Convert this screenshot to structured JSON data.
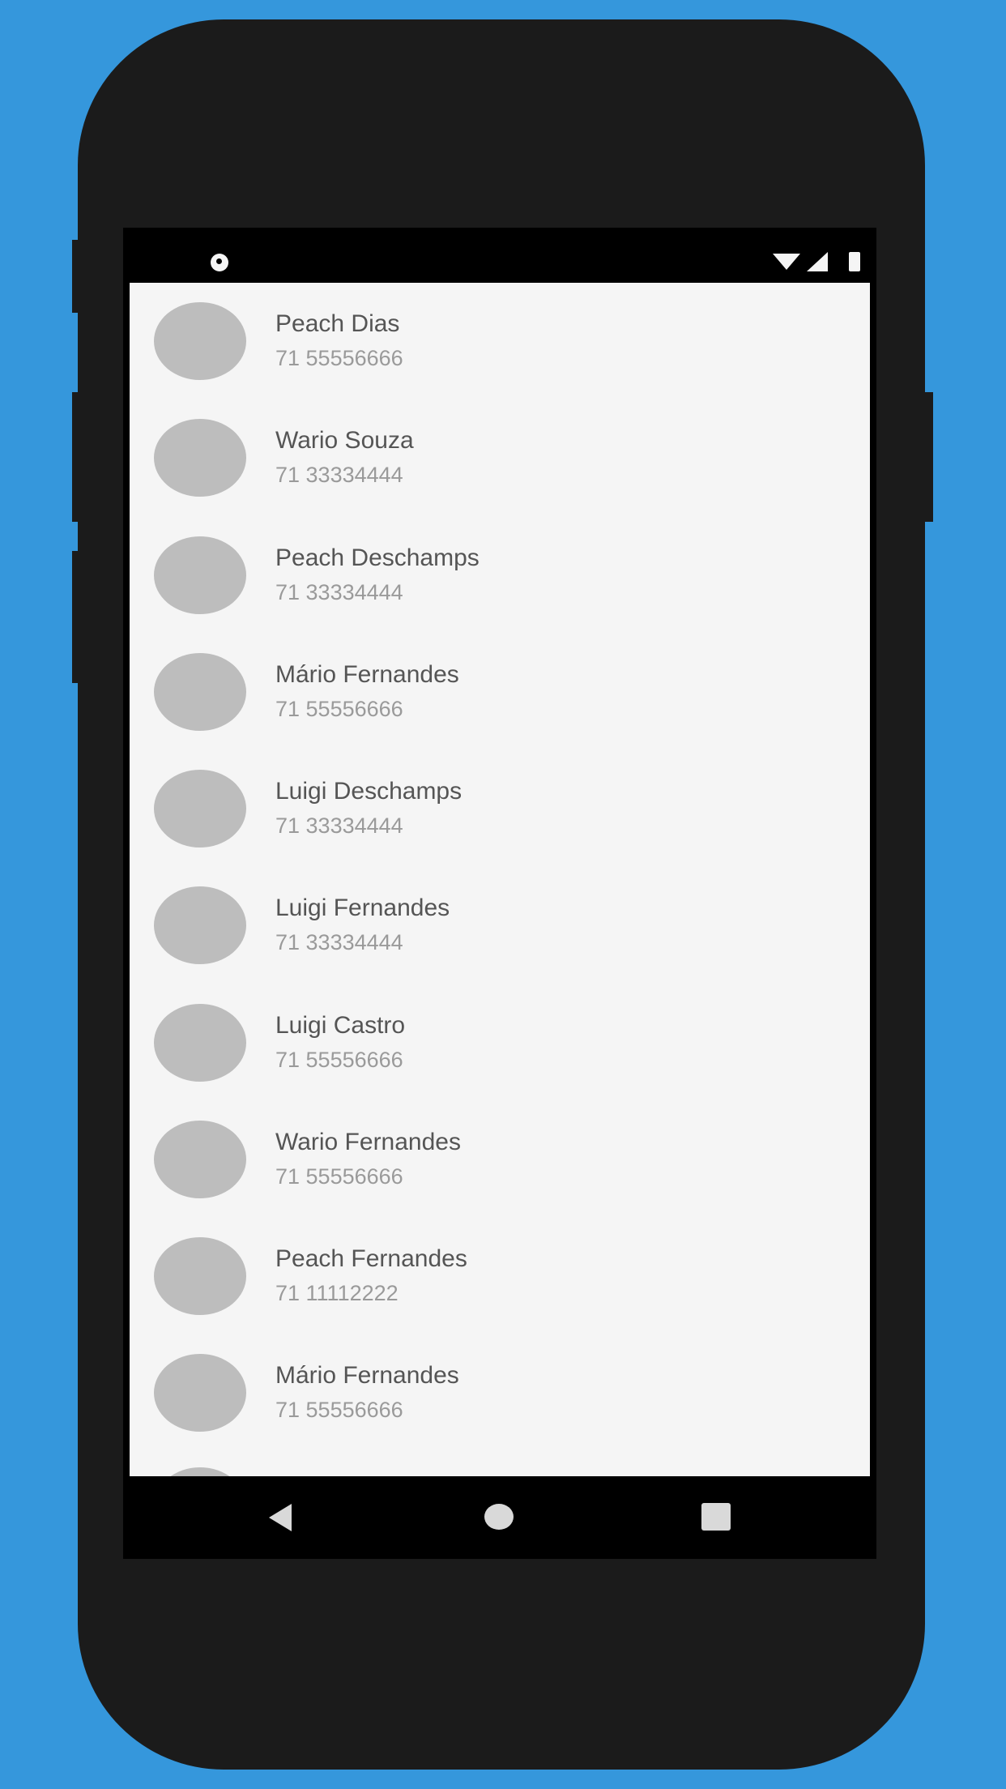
{
  "contacts": [
    {
      "name": "Peach Dias",
      "phone": "71 55556666"
    },
    {
      "name": "Wario Souza",
      "phone": "71 33334444"
    },
    {
      "name": "Peach Deschamps",
      "phone": "71 33334444"
    },
    {
      "name": "Mário Fernandes",
      "phone": "71 55556666"
    },
    {
      "name": "Luigi Deschamps",
      "phone": "71 33334444"
    },
    {
      "name": "Luigi Fernandes",
      "phone": "71 33334444"
    },
    {
      "name": "Luigi Castro",
      "phone": "71 55556666"
    },
    {
      "name": "Wario Fernandes",
      "phone": "71 55556666"
    },
    {
      "name": "Peach Fernandes",
      "phone": "71 11112222"
    },
    {
      "name": "Mário Fernandes",
      "phone": "71 55556666"
    }
  ],
  "icons": {
    "status_app": "app-notification-icon",
    "wifi": "wifi-icon",
    "signal": "cell-signal-icon",
    "battery": "battery-icon",
    "back": "back-icon",
    "home": "home-icon",
    "recents": "recents-icon"
  },
  "colors": {
    "background": "#3597dc",
    "device": "#1b1b1b",
    "list_background": "#f5f5f5",
    "avatar": "#bdbdbd",
    "name_text": "#555555",
    "phone_text": "#9a9a9a"
  }
}
